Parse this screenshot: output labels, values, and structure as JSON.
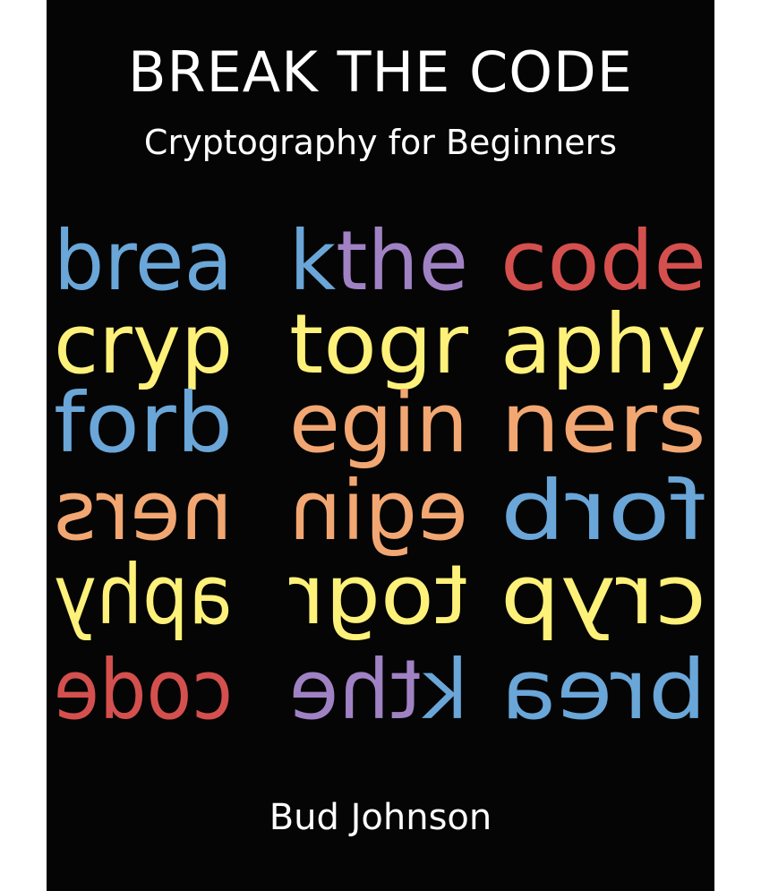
{
  "cover": {
    "title": "BREAK THE CODE",
    "subtitle": "Cryptography for Beginners",
    "author": "Bud Johnson"
  },
  "colors": {
    "background": "#050505",
    "text": "#ffffff",
    "blue": "#6aa6d8",
    "purple": "#a082c4",
    "red": "#d4504e",
    "yellow": "#fef17a",
    "orange": "#f2a772"
  },
  "word_grid": [
    {
      "mirrored": false,
      "words": [
        {
          "parts": [
            {
              "text": "brea",
              "color": "blue"
            }
          ]
        },
        {
          "parts": [
            {
              "text": "k",
              "color": "blue"
            },
            {
              "text": "the",
              "color": "purple"
            }
          ]
        },
        {
          "parts": [
            {
              "text": "code",
              "color": "red"
            }
          ]
        }
      ]
    },
    {
      "mirrored": false,
      "words": [
        {
          "parts": [
            {
              "text": "cryp",
              "color": "yellow"
            }
          ]
        },
        {
          "parts": [
            {
              "text": "togr",
              "color": "yellow"
            }
          ]
        },
        {
          "parts": [
            {
              "text": "aphy",
              "color": "yellow"
            }
          ]
        }
      ]
    },
    {
      "mirrored": false,
      "words": [
        {
          "parts": [
            {
              "text": "forb",
              "color": "blue"
            }
          ]
        },
        {
          "parts": [
            {
              "text": "egin",
              "color": "orange"
            }
          ]
        },
        {
          "parts": [
            {
              "text": "ners",
              "color": "orange"
            }
          ]
        }
      ]
    },
    {
      "mirrored": true,
      "words": [
        {
          "parts": [
            {
              "text": "ners",
              "color": "orange"
            }
          ]
        },
        {
          "parts": [
            {
              "text": "egin",
              "color": "orange"
            }
          ]
        },
        {
          "parts": [
            {
              "text": "forb",
              "color": "blue"
            }
          ]
        }
      ]
    },
    {
      "mirrored": true,
      "words": [
        {
          "parts": [
            {
              "text": "aphy",
              "color": "yellow"
            }
          ]
        },
        {
          "parts": [
            {
              "text": "togr",
              "color": "yellow"
            }
          ]
        },
        {
          "parts": [
            {
              "text": "cryp",
              "color": "yellow"
            }
          ]
        }
      ]
    },
    {
      "mirrored": true,
      "words": [
        {
          "parts": [
            {
              "text": "code",
              "color": "red"
            }
          ]
        },
        {
          "parts": [
            {
              "text": "k",
              "color": "blue"
            },
            {
              "text": "the",
              "color": "purple"
            }
          ]
        },
        {
          "parts": [
            {
              "text": "brea",
              "color": "blue"
            }
          ]
        }
      ]
    }
  ]
}
